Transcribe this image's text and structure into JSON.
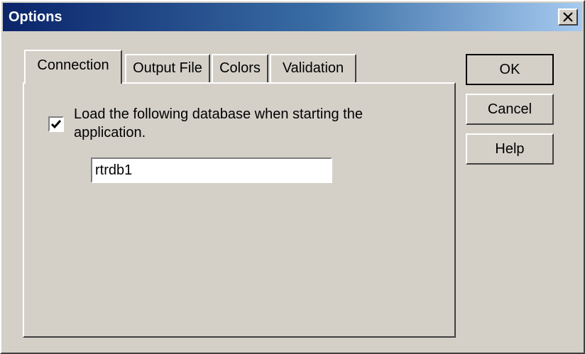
{
  "window": {
    "title": "Options"
  },
  "tabs": [
    {
      "label": "Connection",
      "active": true
    },
    {
      "label": "Output File",
      "active": false
    },
    {
      "label": "Colors",
      "active": false
    },
    {
      "label": "Validation",
      "active": false
    }
  ],
  "connection": {
    "checkbox_checked": true,
    "checkbox_label": "Load the following database when starting the application.",
    "database_value": "rtrdb1"
  },
  "buttons": {
    "ok": "OK",
    "cancel": "Cancel",
    "help": "Help"
  },
  "icons": {
    "close": "close-icon",
    "check": "check-icon"
  }
}
